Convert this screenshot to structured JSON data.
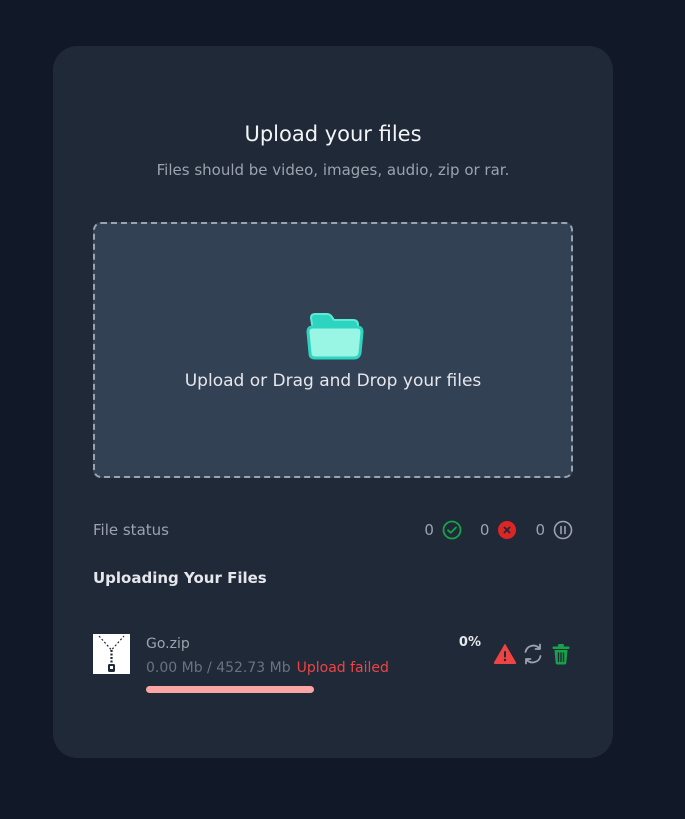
{
  "header": {
    "title": "Upload your files",
    "subtitle": "Files should be video, images, audio, zip or rar."
  },
  "dropzone": {
    "label": "Upload or Drag and Drop your files",
    "icon": "folder-icon"
  },
  "status": {
    "label": "File status",
    "success_count": "0",
    "error_count": "0",
    "paused_count": "0",
    "icons": [
      "check-circle-icon",
      "x-circle-icon",
      "pause-circle-icon"
    ]
  },
  "uploads": {
    "title": "Uploading Your Files",
    "files": [
      {
        "name": "Go.zip",
        "size": "0.00 Mb / 452.73 Mb",
        "status": "Upload failed",
        "percent_label": "0%",
        "progress": 0,
        "thumb_icon": "zip-file-icon",
        "actions": [
          "warning-icon",
          "retry-icon",
          "delete-icon"
        ]
      }
    ]
  },
  "colors": {
    "background": "#111827",
    "card": "#1f2937",
    "dropzone": "#334155",
    "accent": "#5eead4",
    "success": "#16a34a",
    "error": "#ef4444",
    "error_light": "#fca5a5"
  }
}
